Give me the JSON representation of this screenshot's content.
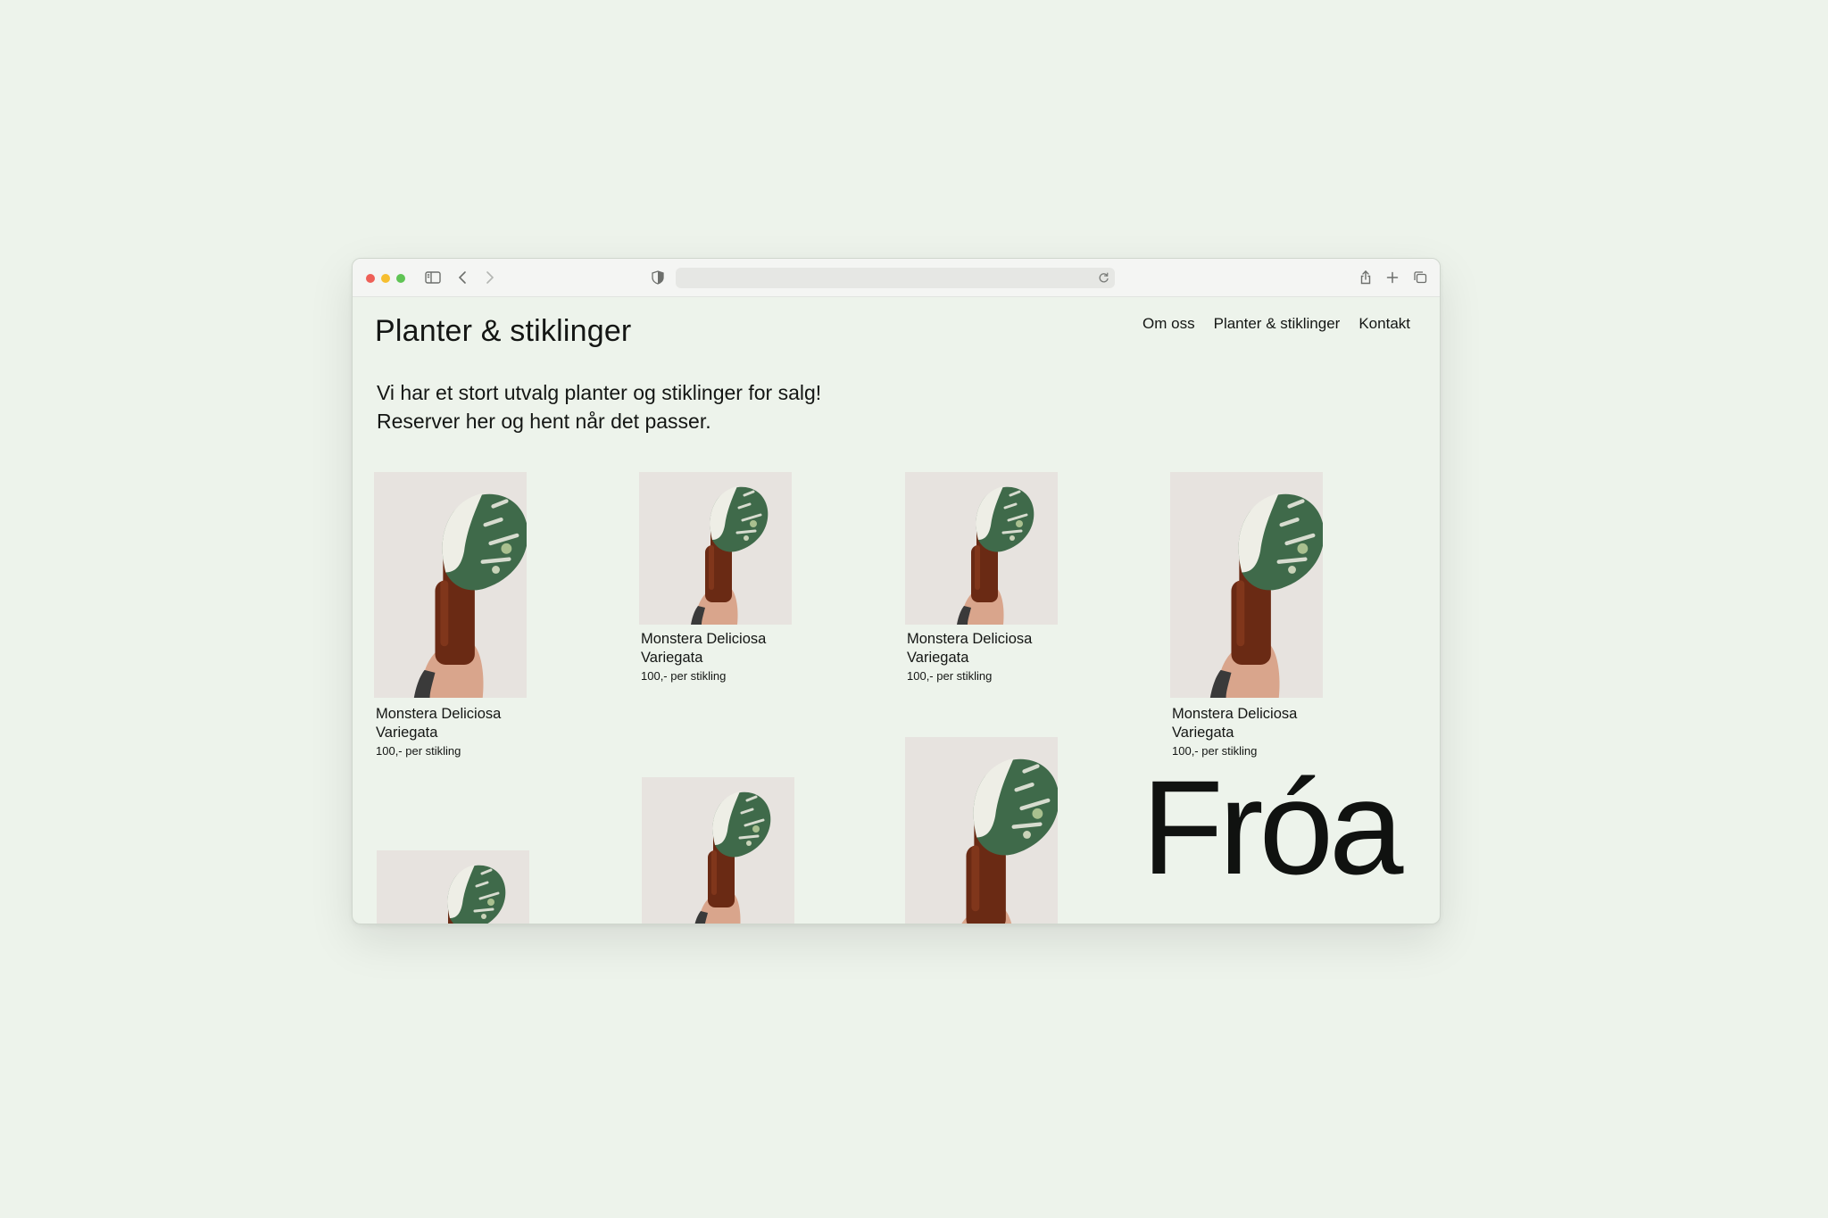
{
  "browser": {
    "address_value": "",
    "icons": [
      "sidebar-icon",
      "back-icon",
      "forward-icon",
      "shield-icon",
      "reload-icon",
      "share-icon",
      "new-tab-icon",
      "tabs-overview-icon"
    ]
  },
  "site": {
    "title": "Planter & stiklinger",
    "nav": [
      "Om oss",
      "Planter & stiklinger",
      "Kontakt"
    ],
    "intro_line1": "Vi har et stort utvalg planter og stiklinger for salg!",
    "intro_line2": "Reserver her og hent når det passer.",
    "logo": "Fróa"
  },
  "products": [
    {
      "name": "Monstera Deliciosa Variegata",
      "price": "100,- per stikling"
    },
    {
      "name": "Monstera Deliciosa Variegata",
      "price": "100,- per stikling"
    },
    {
      "name": "Monstera Deliciosa Variegata",
      "price": "100,- per stikling"
    },
    {
      "name": "Monstera Deliciosa Variegata",
      "price": "100,- per stikling"
    }
  ],
  "colors": {
    "background": "#edf3eb",
    "text": "#141614",
    "bottle": "#6a2a14",
    "leaf_green": "#3f6a4a",
    "leaf_white": "#eeeee6"
  }
}
